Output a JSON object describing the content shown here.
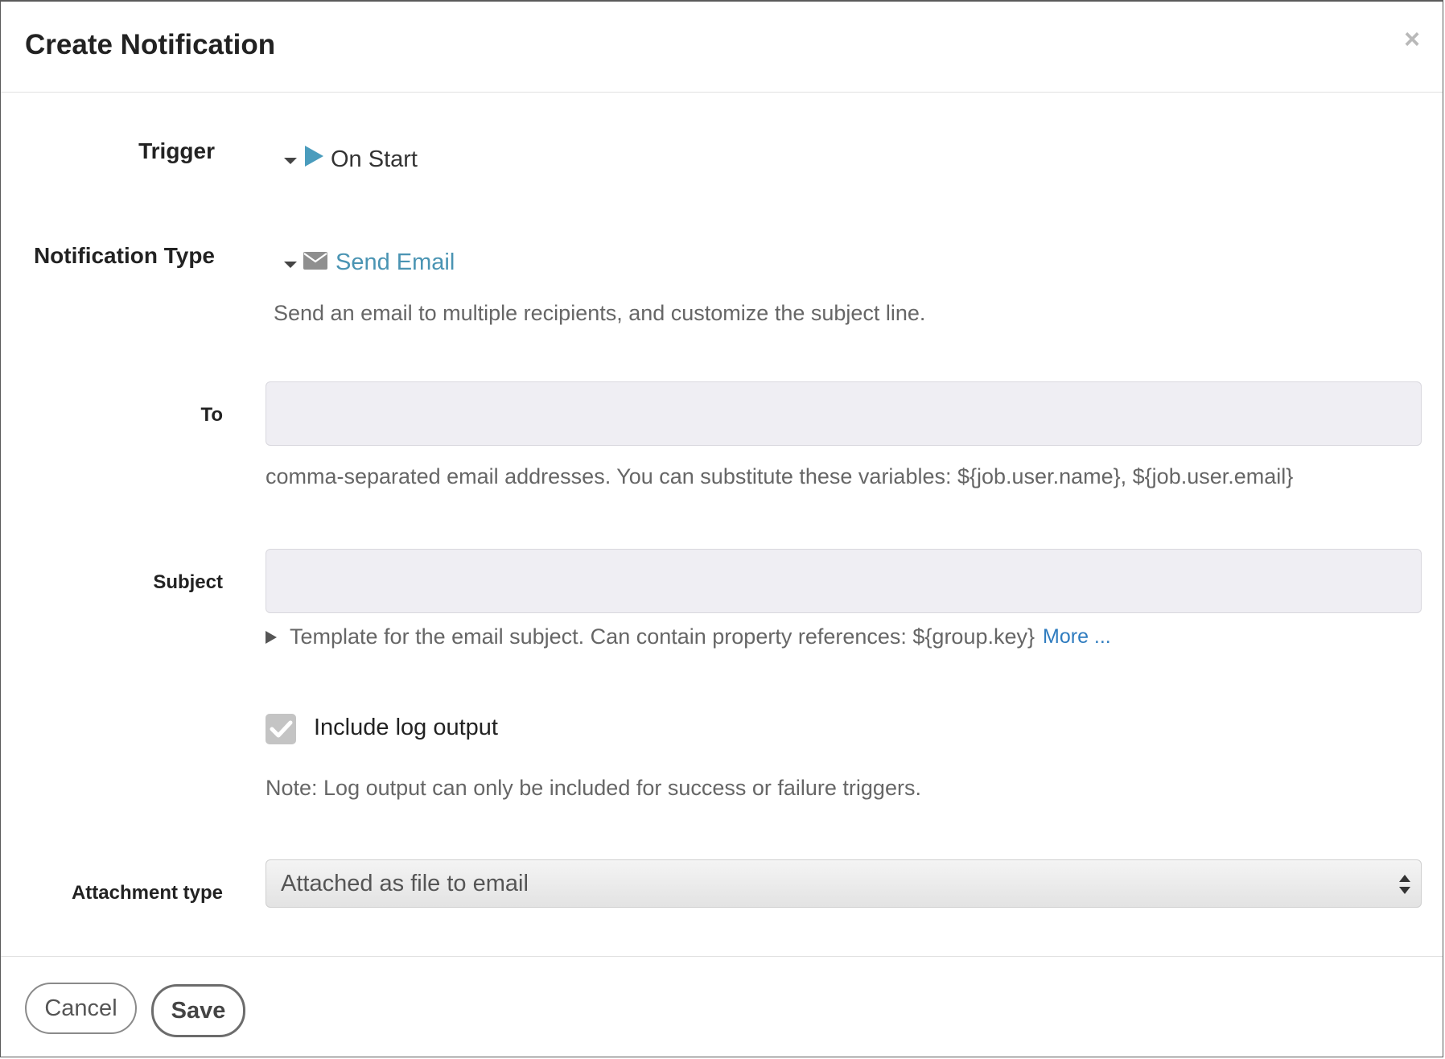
{
  "dialog": {
    "title": "Create Notification",
    "close_symbol": "×"
  },
  "trigger": {
    "label": "Trigger",
    "value": "On Start",
    "icon": "play-icon",
    "icon_color": "#4a9cbd"
  },
  "notification_type": {
    "label": "Notification Type",
    "value": "Send Email",
    "icon": "envelope-icon",
    "value_color": "#4a94b3",
    "description": "Send an email to multiple recipients, and customize the subject line."
  },
  "to": {
    "label": "To",
    "value": "",
    "help": "comma-separated email addresses. You can substitute these variables: ${job.user.name}, ${job.user.email}"
  },
  "subject": {
    "label": "Subject",
    "value": "",
    "help": "Template for the email subject. Can contain property references: ${group.key}",
    "more_link": "More ..."
  },
  "include_log": {
    "label": "Include log output",
    "checked": true,
    "note": "Note: Log output can only be included for success or failure triggers."
  },
  "attachment": {
    "label": "Attachment type",
    "selected": "Attached as file to email"
  },
  "footer": {
    "cancel_label": "Cancel",
    "save_label": "Save"
  }
}
